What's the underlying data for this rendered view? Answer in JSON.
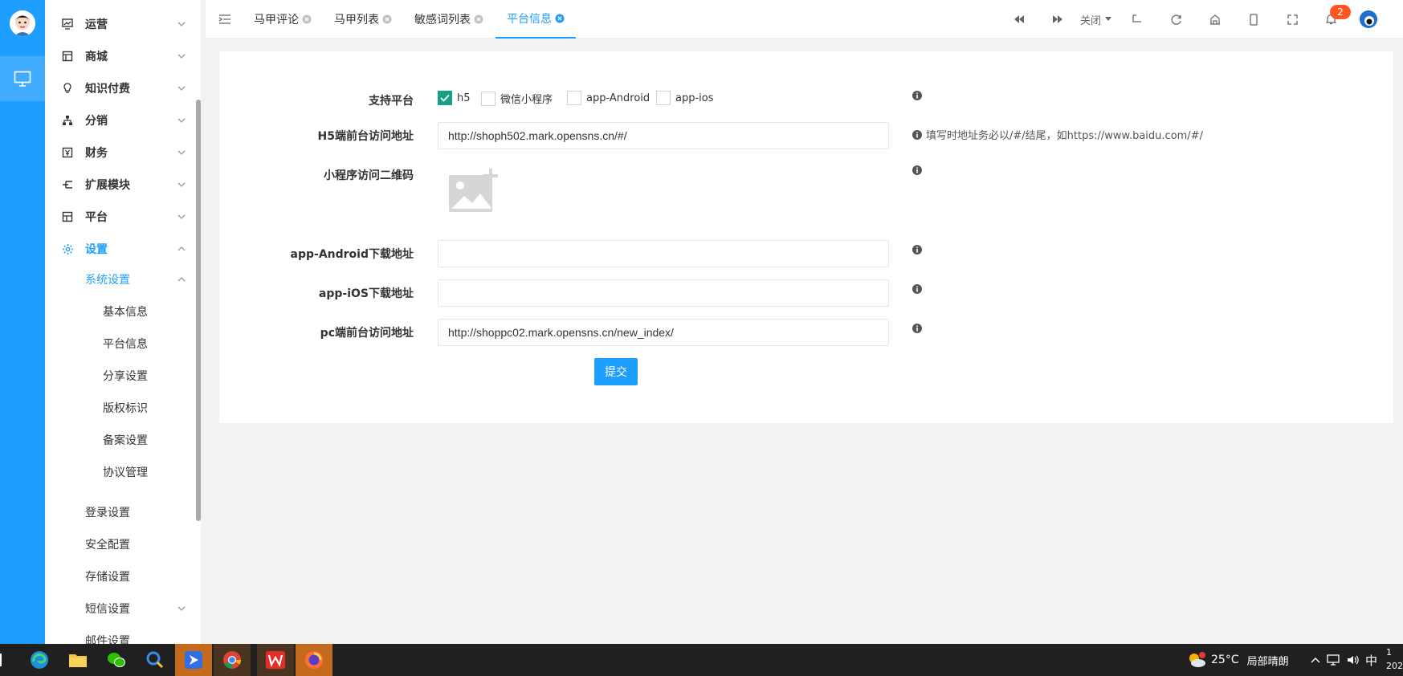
{
  "colors": {
    "accent": "#1e9fff",
    "checkbox": "#16a085",
    "badge": "#ff5722"
  },
  "sidebar": {
    "menu": [
      {
        "label": "运营",
        "icon": "dashboard-icon"
      },
      {
        "label": "商城",
        "icon": "store-icon"
      },
      {
        "label": "知识付费",
        "icon": "bulb-icon"
      },
      {
        "label": "分销",
        "icon": "sitemap-icon"
      },
      {
        "label": "财务",
        "icon": "finance-icon"
      },
      {
        "label": "扩展模块",
        "icon": "extension-icon"
      },
      {
        "label": "平台",
        "icon": "platform-icon"
      },
      {
        "label": "设置",
        "icon": "gear-icon"
      }
    ],
    "sub": {
      "system": "系统设置",
      "login": "登录设置",
      "security": "安全配置",
      "storage": "存储设置",
      "sms": "短信设置",
      "mail": "邮件设置"
    },
    "leaves": [
      "基本信息",
      "平台信息",
      "分享设置",
      "版权标识",
      "备案设置",
      "协议管理"
    ]
  },
  "tabs": [
    {
      "label": "马甲评论"
    },
    {
      "label": "马甲列表"
    },
    {
      "label": "敏感词列表"
    },
    {
      "label": "平台信息"
    }
  ],
  "topbar": {
    "close_label": "关闭",
    "notif_count": "2"
  },
  "form": {
    "support_label": "支持平台",
    "options": [
      "h5",
      "微信小程序",
      "app-Android",
      "app-ios"
    ],
    "checked": [
      "h5"
    ],
    "h5_label": "H5端前台访问地址",
    "h5_value": "http://shoph502.mark.opensns.cn/#/",
    "h5_hint": "填写时地址务必以/#/结尾，如https://www.baidu.com/#/",
    "qr_label": "小程序访问二维码",
    "android_label": "app-Android下载地址",
    "android_value": "",
    "ios_label": "app-iOS下载地址",
    "ios_value": "",
    "pc_label": "pc端前台访问地址",
    "pc_value": "http://shoppc02.mark.opensns.cn/new_index/",
    "submit": "提交"
  },
  "taskbar": {
    "weather": "25°C",
    "weather_desc": "局部晴朗",
    "ime": "中",
    "clock_top": "1",
    "clock_bottom": "202"
  }
}
